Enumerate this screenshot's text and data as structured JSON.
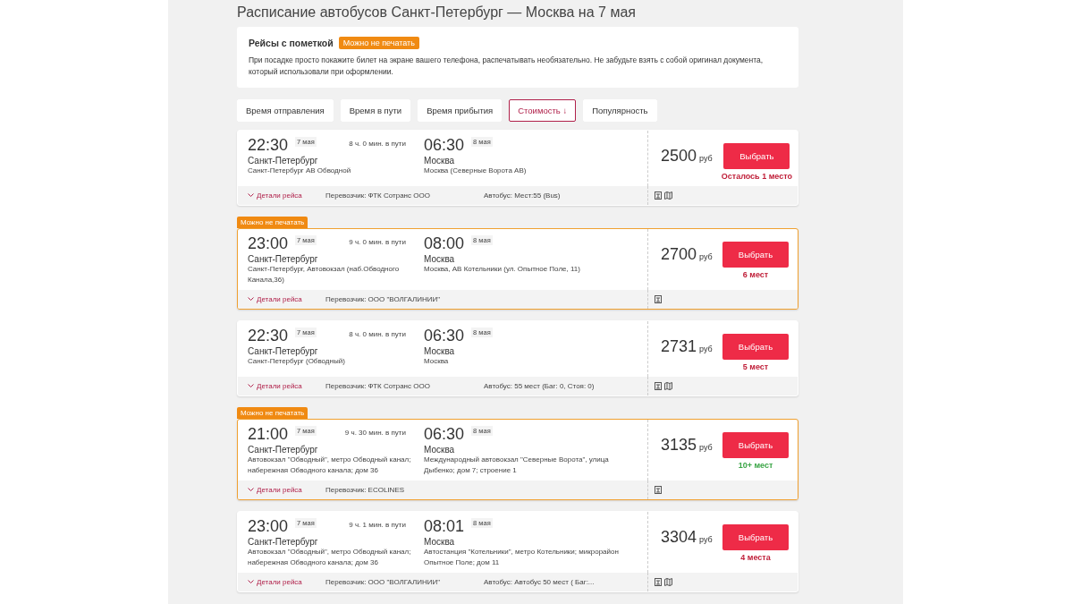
{
  "title": "Расписание автобусов Санкт-Петербург — Москва на 7 мая",
  "notice": {
    "heading": "Рейсы с пометкой",
    "badge": "Можно не печатать",
    "text": "При посадке просто покажите билет на экране вашего телефона, распечатывать необязательно. Не забудьте взять с собой оригинал документа, который использовали при оформлении."
  },
  "sort_tabs": [
    {
      "label": "Время отправления",
      "selected": false
    },
    {
      "label": "Время в пути",
      "selected": false
    },
    {
      "label": "Время прибытия",
      "selected": false
    },
    {
      "label": "Стоимость ↓",
      "selected": true
    },
    {
      "label": "Популярность",
      "selected": false
    }
  ],
  "trips": [
    {
      "highlighted": false,
      "depart_time": "22:30",
      "depart_date": "7 мая",
      "duration": "8 ч. 0 мин. в пути",
      "arrive_time": "06:30",
      "arrive_date": "8 мая",
      "from_city": "Санкт-Петербург",
      "from_station": "Санкт-Петербург АВ Обводной",
      "to_city": "Москва",
      "to_station": "Москва (Северные Ворота АВ)",
      "price": "2500",
      "currency": "руб",
      "button": "Выбрать",
      "seats": {
        "text": "Осталось 1 место",
        "color": "#c0203a"
      },
      "details": "Детали рейса",
      "carrier": "Перевозчик: ФТК Сотранс ООО",
      "bus": "Автобус: Мест:55 (Bus)",
      "seat_map": true
    },
    {
      "tag": "Можно не печатать",
      "highlighted": true,
      "depart_time": "23:00",
      "depart_date": "7 мая",
      "duration": "9 ч. 0 мин. в пути",
      "arrive_time": "08:00",
      "arrive_date": "8 мая",
      "from_city": "Санкт-Петербург",
      "from_station": "Санкт-Петербург, Автовокзал (наб.Обводного Канала,36)",
      "to_city": "Москва",
      "to_station": "Москва, АВ Котельники (ул. Опытное Поле, 11)",
      "price": "2700",
      "currency": "руб",
      "button": "Выбрать",
      "seats": {
        "text": "6 мест",
        "color": "#c0203a"
      },
      "details": "Детали рейса",
      "carrier": "Перевозчик: ООО \"ВОЛГАЛИНИИ\"",
      "seat_map": false
    },
    {
      "highlighted": false,
      "depart_time": "22:30",
      "depart_date": "7 мая",
      "duration": "8 ч. 0 мин. в пути",
      "arrive_time": "06:30",
      "arrive_date": "8 мая",
      "from_city": "Санкт-Петербург",
      "from_station": "Санкт-Петербург (Обводный)",
      "to_city": "Москва",
      "to_station": "Москва",
      "price": "2731",
      "currency": "руб",
      "button": "Выбрать",
      "seats": {
        "text": "5 мест",
        "color": "#c0203a"
      },
      "details": "Детали рейса",
      "carrier": "Перевозчик: ФТК Сотранс ООО",
      "bus": "Автобус: 55 мест (Баг: 0, Стоя: 0)",
      "seat_map": true
    },
    {
      "tag": "Можно не печатать",
      "highlighted": true,
      "depart_time": "21:00",
      "depart_date": "7 мая",
      "duration": "9 ч. 30 мин. в пути",
      "arrive_time": "06:30",
      "arrive_date": "8 мая",
      "from_city": "Санкт-Петербург",
      "from_station": "Автовокзал \"Обводный\", метро Обводный канал; набережная Обводного канала; дом 36",
      "to_city": "Москва",
      "to_station": "Международный автовокзал \"Северные Ворота\", улица Дыбенко; дом 7; строение 1",
      "price": "3135",
      "currency": "руб",
      "button": "Выбрать",
      "seats": {
        "text": "10+ мест",
        "color": "#3aa546"
      },
      "details": "Детали рейса",
      "carrier": "Перевозчик: ECOLINES",
      "seat_map": false
    },
    {
      "highlighted": false,
      "depart_time": "23:00",
      "depart_date": "7 мая",
      "duration": "9 ч. 1 мин. в пути",
      "arrive_time": "08:01",
      "arrive_date": "8 мая",
      "from_city": "Санкт-Петербург",
      "from_station": "Автовокзал \"Обводный\", метро Обводный канал; набережная Обводного канала; дом 36",
      "to_city": "Москва",
      "to_station": "Автостанция \"Котельники\", метро Котельники; микрорайон Опытное Поле; дом 11",
      "price": "3304",
      "currency": "руб",
      "button": "Выбрать",
      "seats": {
        "text": "4 места",
        "color": "#c0203a"
      },
      "details": "Детали рейса",
      "carrier": "Перевозчик: ООО \"ВОЛГАЛИНИИ\"",
      "bus": "Автобус: Автобус 50 мест ( Баг:...",
      "seat_map": true
    }
  ]
}
